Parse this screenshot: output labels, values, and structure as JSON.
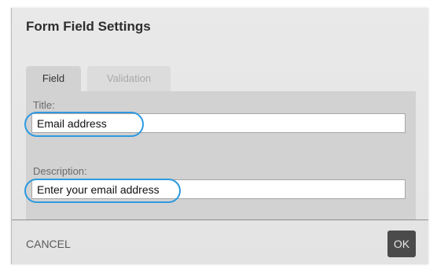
{
  "dialog": {
    "title": "Form Field Settings"
  },
  "tabs": [
    {
      "label": "Field",
      "active": true
    },
    {
      "label": "Validation",
      "active": false
    }
  ],
  "fields": {
    "title": {
      "label": "Title:",
      "value": "Email address"
    },
    "description": {
      "label": "Description:",
      "value": "Enter your email address"
    }
  },
  "actions": {
    "cancel_label": "CANCEL",
    "ok_label": "OK"
  },
  "colors": {
    "highlight": "#2e9ae0",
    "ok_button": "#4b4b4b",
    "panel": "#d2d2d2"
  }
}
